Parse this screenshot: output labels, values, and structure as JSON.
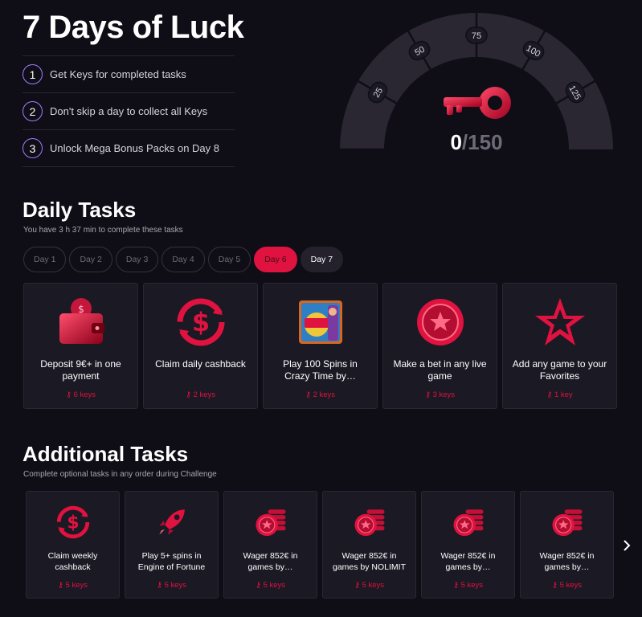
{
  "header": {
    "title": "7 Days of Luck",
    "steps": [
      {
        "num": "1",
        "text": "Get Keys for completed tasks"
      },
      {
        "num": "2",
        "text": "Don't skip a day to collect all Keys"
      },
      {
        "num": "3",
        "text": "Unlock Mega Bonus Packs on Day 8"
      }
    ]
  },
  "gauge": {
    "current": "0",
    "max": "/150",
    "ticks": [
      "25",
      "50",
      "75",
      "100",
      "125"
    ],
    "progress_fraction": 0
  },
  "daily": {
    "title": "Daily Tasks",
    "subtitle": "You have 3 h 37 min to complete these tasks",
    "days": [
      "Day 1",
      "Day 2",
      "Day 3",
      "Day 4",
      "Day 5",
      "Day 6",
      "Day 7"
    ],
    "tasks": [
      {
        "name": "Deposit 9€+ in one payment",
        "keys": "6 keys",
        "icon": "wallet-icon"
      },
      {
        "name": "Claim daily cashback",
        "keys": "2 keys",
        "icon": "cashback-icon"
      },
      {
        "name": "Play 100 Spins in Crazy Time by…",
        "keys": "2 keys",
        "icon": "crazy-time-icon"
      },
      {
        "name": "Make a bet in any live game",
        "keys": "3 keys",
        "icon": "chip-icon"
      },
      {
        "name": "Add any game to your Favorites",
        "keys": "1 key",
        "icon": "star-icon"
      }
    ]
  },
  "additional": {
    "title": "Additional Tasks",
    "subtitle": "Complete optional tasks in any order during Challenge",
    "tasks": [
      {
        "name": "Claim weekly cashback",
        "keys": "5 keys",
        "icon": "cashback-icon"
      },
      {
        "name": "Play 5+ spins in Engine of Fortune",
        "keys": "5 keys",
        "icon": "rocket-icon"
      },
      {
        "name": "Wager 852€ in games by…",
        "keys": "5 keys",
        "icon": "chips-stack-icon"
      },
      {
        "name": "Wager 852€ in games by NOLIMIT",
        "keys": "5 keys",
        "icon": "chips-stack-icon"
      },
      {
        "name": "Wager 852€ in games by…",
        "keys": "5 keys",
        "icon": "chips-stack-icon"
      },
      {
        "name": "Wager 852€ in games by…",
        "keys": "5 keys",
        "icon": "chips-stack-icon"
      }
    ]
  },
  "colors": {
    "accent": "#e0123f",
    "purple": "#a57cff",
    "card": "#1b1924"
  }
}
